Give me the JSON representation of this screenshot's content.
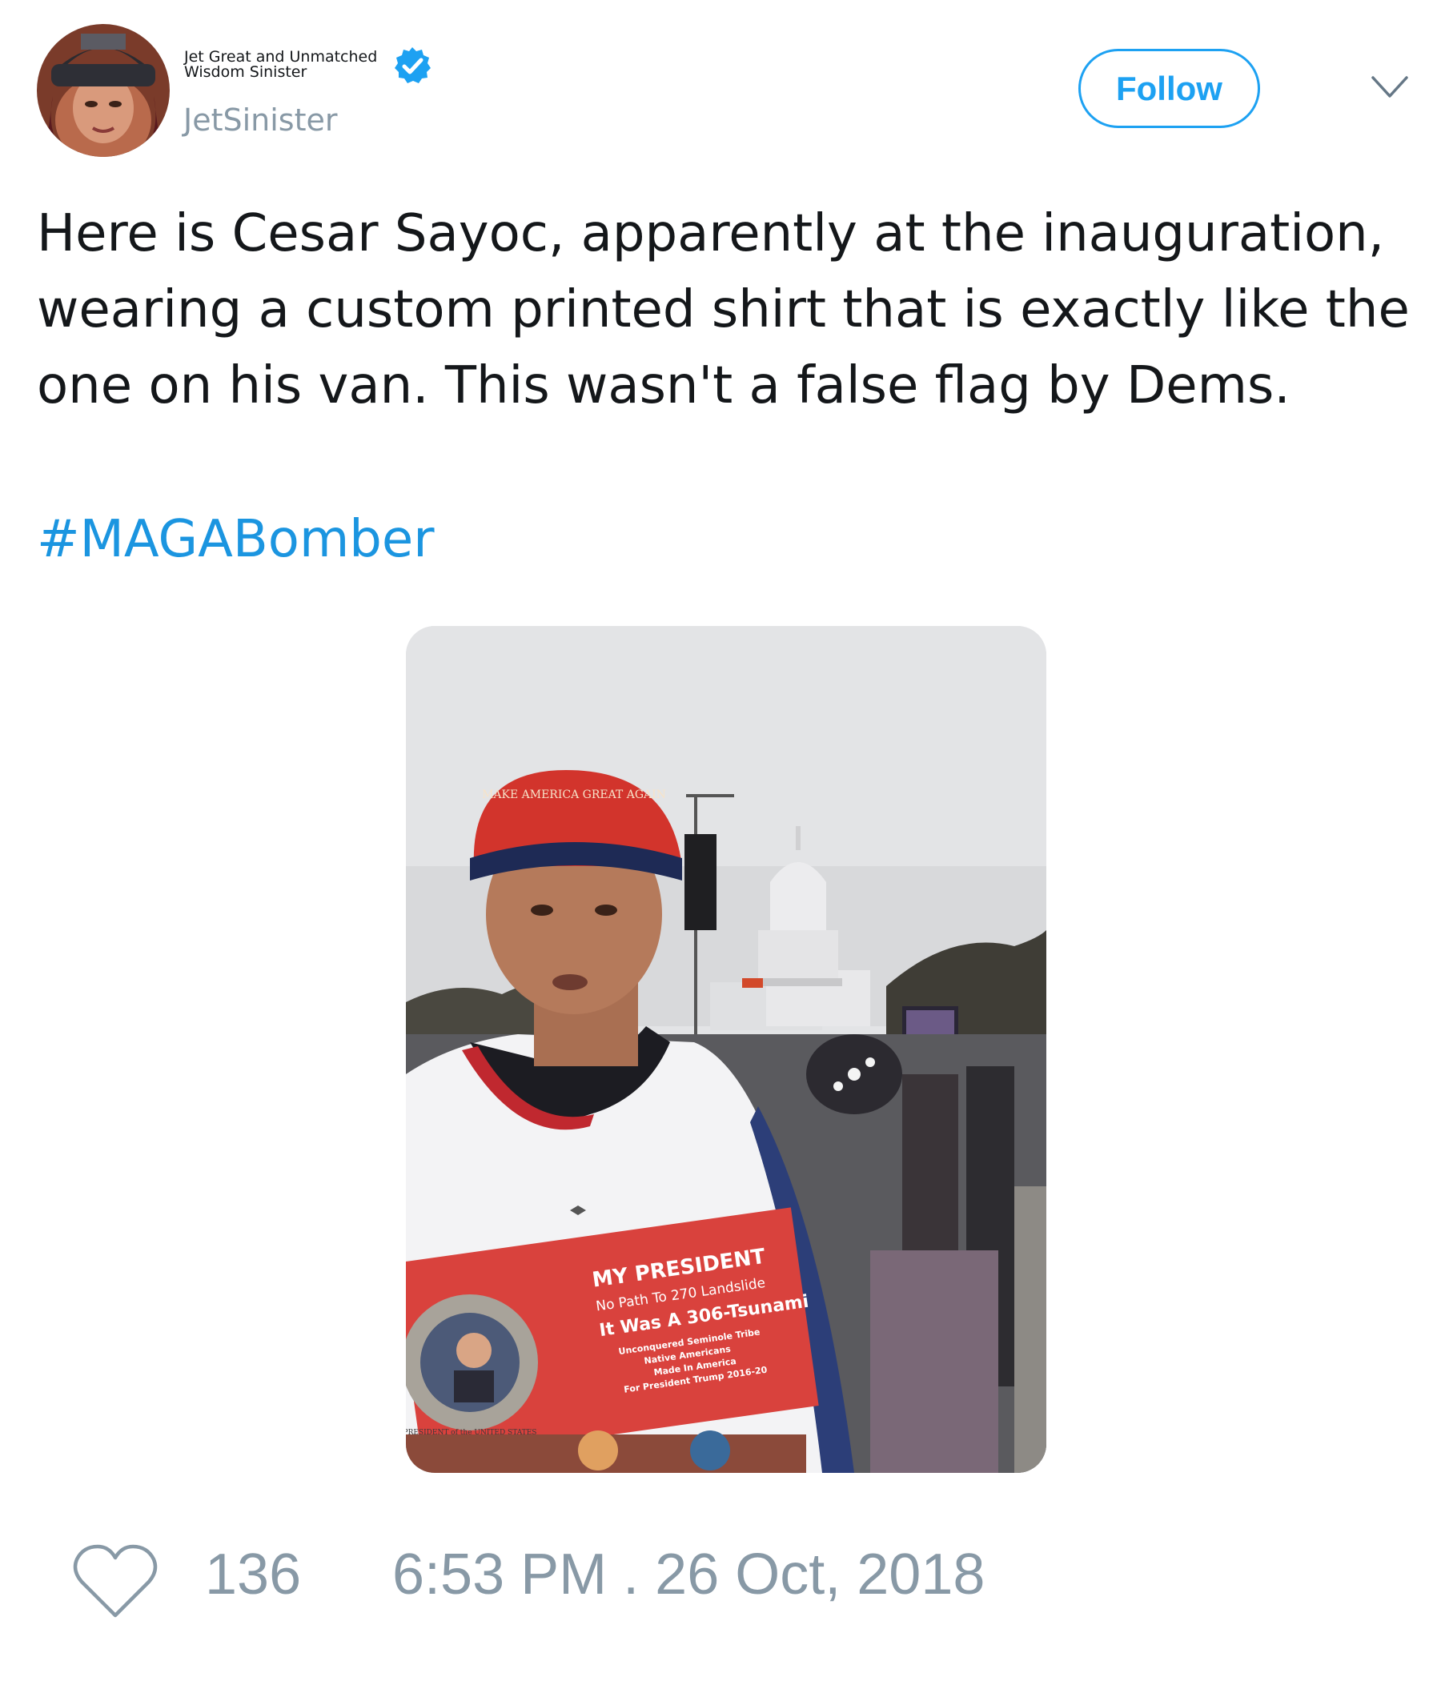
{
  "tweet": {
    "author": {
      "display_name": "Jet Great and Unmatched Wisdom Sinister",
      "handle": "JetSinister",
      "verified": true,
      "avatar_icon": "user-avatar"
    },
    "follow_label": "Follow",
    "menu_icon": "chevron-down-icon",
    "text": "Here is Cesar Sayoc, apparently at the inauguration, wearing a custom printed shirt that is exactly like the one on his van. This wasn't a false flag by Dems.",
    "hashtag": "#MAGABomber",
    "photo": {
      "shirt_lines": [
        "MY PRESIDENT",
        "No Path To 270 Landslide",
        "It Was A 306-Tsunami",
        "Unconquered Seminole Tribe",
        "Native Americans",
        "Made In America",
        "For President Trump 2016-20"
      ],
      "hat_text": "MAKE AMERICA GREAT AGAIN",
      "seal_text": "PRESIDENT of the UNITED STATES"
    },
    "like_count": "136",
    "timestamp": "6:53 PM . 26 Oct, 2018"
  },
  "colors": {
    "accent": "#1da1f2",
    "hashtag": "#1b95e0",
    "muted": "#8899a6",
    "text": "#14171a"
  }
}
